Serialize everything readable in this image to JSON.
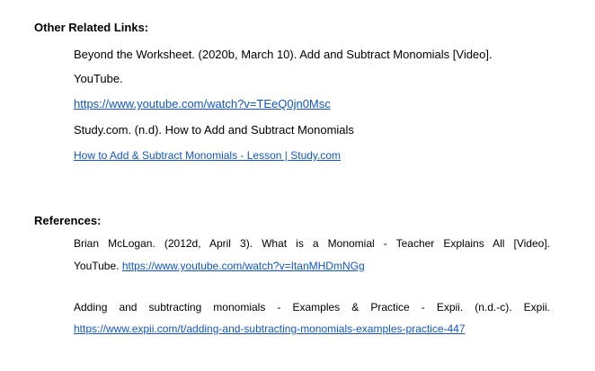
{
  "related": {
    "heading": "Other Related Links:",
    "ref1_line1": "Beyond the Worksheet. (2020b, March 10). Add and Subtract Monomials [Video].",
    "ref1_line2": "YouTube.",
    "ref1_url": "https://www.youtube.com/watch?v=TEeQ0jn0Msc",
    "ref2_line1": "Study.com. (n.d). How to Add and Subtract Monomials",
    "ref2_link": "How to Add & Subtract Monomials - Lesson | Study.com"
  },
  "references": {
    "heading": "References:",
    "ref1_line1": "Brian McLogan. (2012d, April 3). What is a Monomial - Teacher Explains All [Video].",
    "ref1_line2_prefix": "YouTube.",
    "ref1_url": "https://www.youtube.com/watch?v=ItanMHDmNGg",
    "ref2_line1": "Adding and subtracting monomials - Examples & Practice - Expii. (n.d.-c). Expii.",
    "ref2_url": "https://www.expii.com/t/adding-and-subtracting-monomials-examples-practice-447"
  }
}
